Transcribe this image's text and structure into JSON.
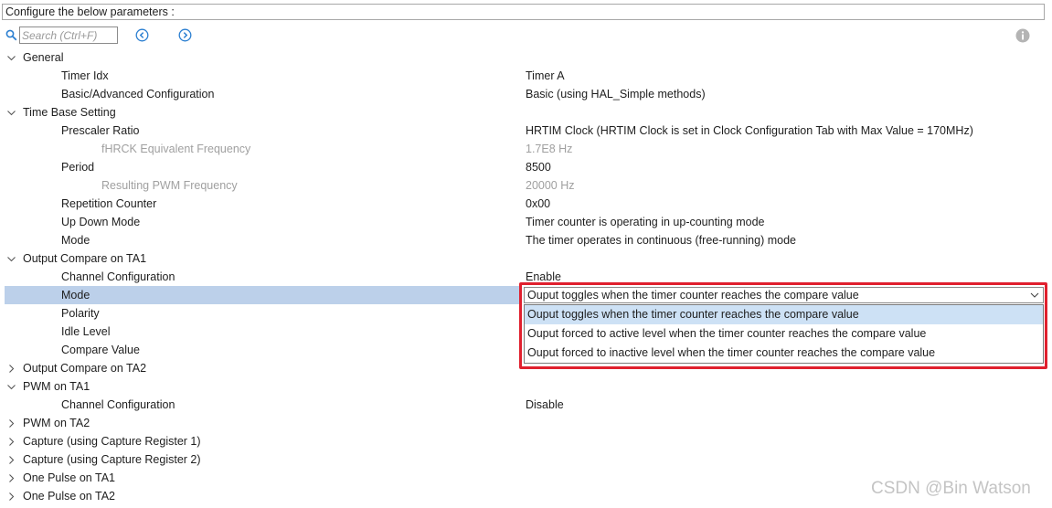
{
  "header": {
    "title": "Configure the below parameters :"
  },
  "search": {
    "placeholder": "Search (Ctrl+F)"
  },
  "icons": {
    "search": "search-icon",
    "prev": "arrow-left-circle-icon",
    "next": "arrow-right-circle-icon",
    "info": "info-icon",
    "expanded": "chevron-down-icon",
    "collapsed": "chevron-right-icon"
  },
  "colors": {
    "selection": "#bcd0ea",
    "highlight_frame": "#e0202e",
    "option_hover": "#cde1f5",
    "accent": "#2b7fd1"
  },
  "tree": {
    "rows": [
      {
        "label": "General",
        "value": ""
      },
      {
        "label": "Timer Idx",
        "value": "Timer A"
      },
      {
        "label": "Basic/Advanced Configuration",
        "value": "Basic (using  HAL_Simple methods)"
      },
      {
        "label": "Time Base Setting",
        "value": ""
      },
      {
        "label": "Prescaler Ratio",
        "value": "HRTIM Clock (HRTIM Clock is set in Clock Configuration Tab with Max Value = 170MHz)"
      },
      {
        "label": "fHRCK Equivalent Frequency",
        "value": "1.7E8 Hz"
      },
      {
        "label": "Period",
        "value": "8500"
      },
      {
        "label": "Resulting PWM Frequency",
        "value": "20000 Hz"
      },
      {
        "label": "Repetition Counter",
        "value": "0x00"
      },
      {
        "label": "Up Down Mode",
        "value": "Timer counter is operating in up-counting mode"
      },
      {
        "label": "Mode",
        "value": "The timer operates in continuous (free-running) mode"
      },
      {
        "label": "Output Compare on TA1",
        "value": ""
      },
      {
        "label": "Channel Configuration",
        "value": "Enable"
      },
      {
        "label": "Mode",
        "value": ""
      },
      {
        "label": "Polarity",
        "value": ""
      },
      {
        "label": "Idle Level",
        "value": ""
      },
      {
        "label": "Compare Value",
        "value": ""
      },
      {
        "label": "Output Compare on TA2",
        "value": ""
      },
      {
        "label": "PWM on TA1",
        "value": ""
      },
      {
        "label": "Channel Configuration",
        "value": "Disable"
      },
      {
        "label": "PWM on TA2",
        "value": ""
      },
      {
        "label": "Capture (using Capture Register 1)",
        "value": ""
      },
      {
        "label": "Capture (using Capture Register 2)",
        "value": ""
      },
      {
        "label": "One Pulse on TA1",
        "value": ""
      },
      {
        "label": "One Pulse on TA2",
        "value": ""
      }
    ]
  },
  "mode_select": {
    "selected": "Ouput toggles when the timer counter reaches the compare value",
    "options": [
      "Ouput toggles when the timer counter reaches the compare value",
      "Ouput forced to active level when the timer counter reaches the compare value",
      "Ouput forced to inactive level when the timer counter reaches the compare value"
    ]
  },
  "watermark": "CSDN @Bin Watson"
}
